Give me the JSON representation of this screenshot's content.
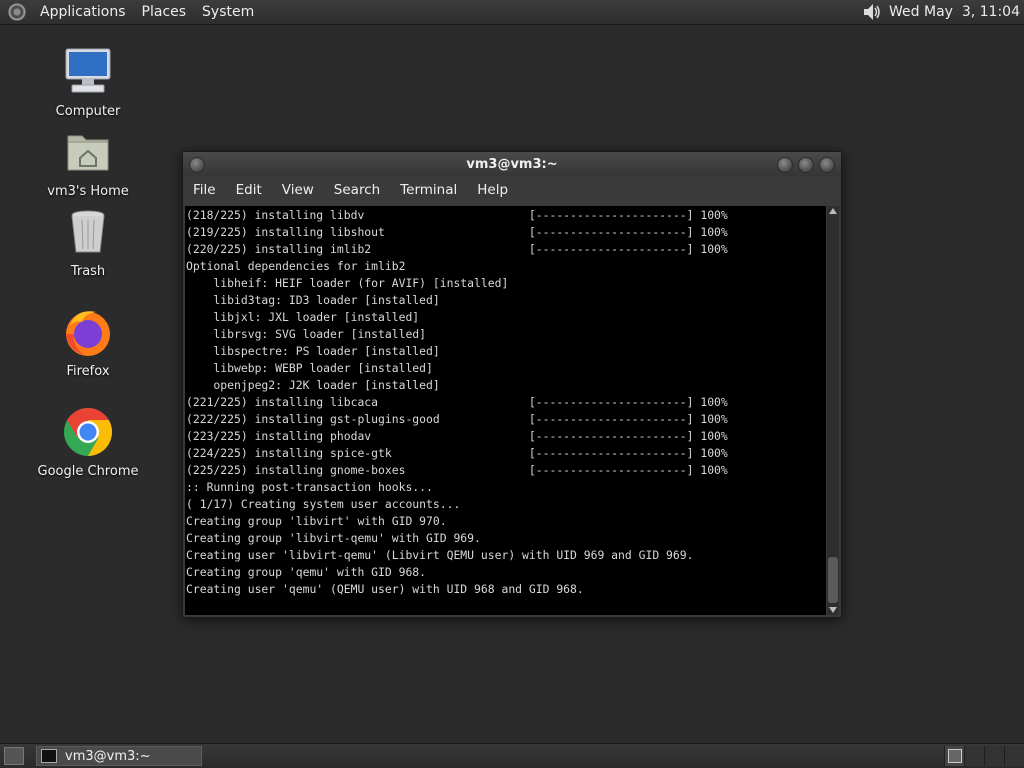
{
  "top_panel": {
    "menus": [
      "Applications",
      "Places",
      "System"
    ],
    "clock": "Wed May  3, 11:04",
    "icons": {
      "logo": "distro-logo-icon",
      "volume": "speaker-icon"
    }
  },
  "desktop": {
    "icons": [
      {
        "label": "Computer",
        "icon": "monitor-icon"
      },
      {
        "label": "vm3's Home",
        "icon": "home-folder-icon"
      },
      {
        "label": "Trash",
        "icon": "trash-icon"
      },
      {
        "label": "Firefox",
        "icon": "firefox-icon"
      },
      {
        "label": "Google Chrome",
        "icon": "chrome-icon"
      }
    ]
  },
  "window": {
    "title": "vm3@vm3:~",
    "menu": [
      "File",
      "Edit",
      "View",
      "Search",
      "Terminal",
      "Help"
    ],
    "terminal_lines": [
      "(218/225) installing libdv                        [----------------------] 100%",
      "(219/225) installing libshout                     [----------------------] 100%",
      "(220/225) installing imlib2                       [----------------------] 100%",
      "Optional dependencies for imlib2",
      "    libheif: HEIF loader (for AVIF) [installed]",
      "    libid3tag: ID3 loader [installed]",
      "    libjxl: JXL loader [installed]",
      "    librsvg: SVG loader [installed]",
      "    libspectre: PS loader [installed]",
      "    libwebp: WEBP loader [installed]",
      "    openjpeg2: J2K loader [installed]",
      "(221/225) installing libcaca                      [----------------------] 100%",
      "(222/225) installing gst-plugins-good             [----------------------] 100%",
      "(223/225) installing phodav                       [----------------------] 100%",
      "(224/225) installing spice-gtk                    [----------------------] 100%",
      "(225/225) installing gnome-boxes                  [----------------------] 100%",
      ":: Running post-transaction hooks...",
      "( 1/17) Creating system user accounts...",
      "Creating group 'libvirt' with GID 970.",
      "Creating group 'libvirt-qemu' with GID 969.",
      "Creating user 'libvirt-qemu' (Libvirt QEMU user) with UID 969 and GID 969.",
      "Creating group 'qemu' with GID 968.",
      "Creating user 'qemu' (QEMU user) with UID 968 and GID 968."
    ]
  },
  "bottom_panel": {
    "task_label": "vm3@vm3:~",
    "workspace_count": 4,
    "active_workspace": 1
  }
}
